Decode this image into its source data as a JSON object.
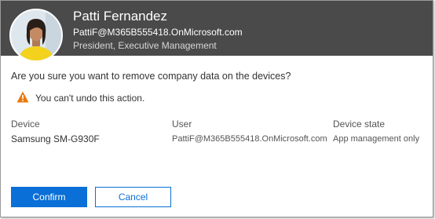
{
  "header": {
    "name": "Patti Fernandez",
    "email": "PattiF@M365B555418.OnMicrosoft.com",
    "role": "President, Executive Management"
  },
  "body": {
    "question": "Are you sure you want to remove company data on the devices?",
    "warning": "You can't undo this action.",
    "warning_icon": "warning-triangle-icon",
    "warning_color": "#e8790c"
  },
  "table": {
    "headers": [
      "Device",
      "User",
      "Device state"
    ],
    "rows": [
      [
        "Samsung SM-G930F",
        "PattiF@M365B555418.OnMicrosoft.com",
        "App management only"
      ]
    ]
  },
  "buttons": {
    "confirm": "Confirm",
    "cancel": "Cancel"
  },
  "colors": {
    "header_bg": "#4a4a4a",
    "accent": "#0a6fd6"
  }
}
